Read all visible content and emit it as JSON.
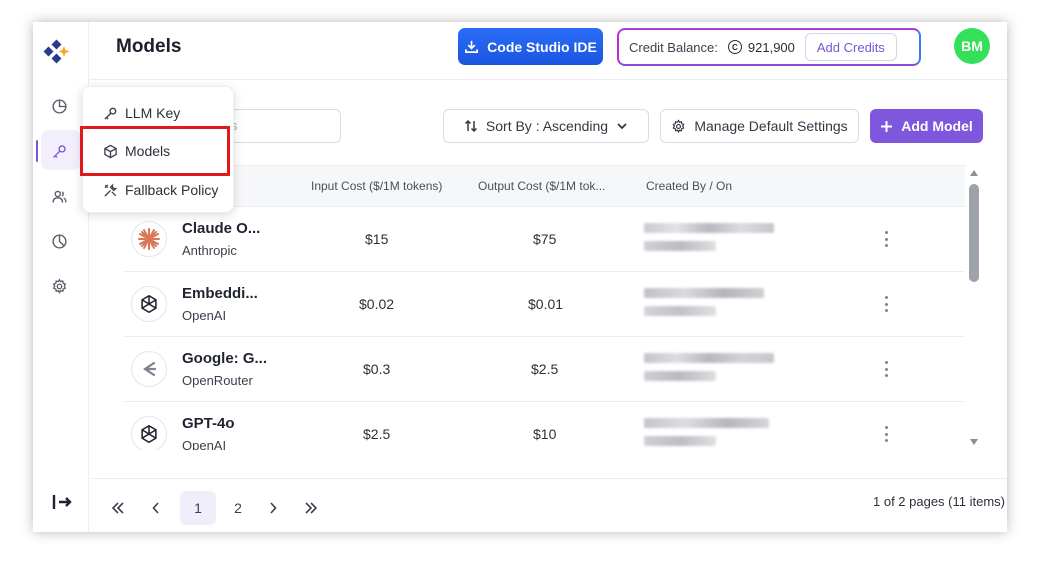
{
  "header": {
    "title": "Models",
    "ide_button": "Code Studio IDE",
    "credit_label": "Credit Balance:",
    "credit_value": "921,900",
    "add_credits": "Add Credits",
    "avatar_initials": "BM"
  },
  "sidebar": {
    "icons": [
      "dashboard-icon",
      "key-icon",
      "users-icon",
      "analytics-icon",
      "settings-icon",
      "logout-icon"
    ],
    "submenu": [
      {
        "label": "LLM Key",
        "icon": "key-icon"
      },
      {
        "label": "Models",
        "icon": "cube-icon"
      },
      {
        "label": "Fallback Policy",
        "icon": "tools-icon"
      }
    ]
  },
  "toolbar": {
    "search_placeholder": "ls",
    "sort_label": "Sort By : Ascending",
    "manage_label": "Manage Default Settings",
    "add_model_label": "Add Model"
  },
  "table": {
    "columns": [
      "Input Cost ($/1M tokens)",
      "Output Cost ($/1M tok...",
      "Created By / On"
    ],
    "rows": [
      {
        "name": "Claude O...",
        "provider": "Anthropic",
        "input_cost": "$15",
        "output_cost": "$75",
        "icon": "anthropic-icon"
      },
      {
        "name": "Embeddi...",
        "provider": "OpenAI",
        "input_cost": "$0.02",
        "output_cost": "$0.01",
        "icon": "openai-icon"
      },
      {
        "name": "Google: G...",
        "provider": "OpenRouter",
        "input_cost": "$0.3",
        "output_cost": "$2.5",
        "icon": "openrouter-icon"
      },
      {
        "name": "GPT-4o",
        "provider": "OpenAI",
        "input_cost": "$2.5",
        "output_cost": "$10",
        "icon": "openai-icon"
      }
    ]
  },
  "pagination": {
    "pages": [
      "1",
      "2"
    ],
    "current": "1",
    "info": "1 of 2 pages (11 items)"
  },
  "colors": {
    "accent": "#7e57dc",
    "ide_button": "#2b6df7",
    "avatar": "#34e05a",
    "highlight": "#e01a1a"
  }
}
